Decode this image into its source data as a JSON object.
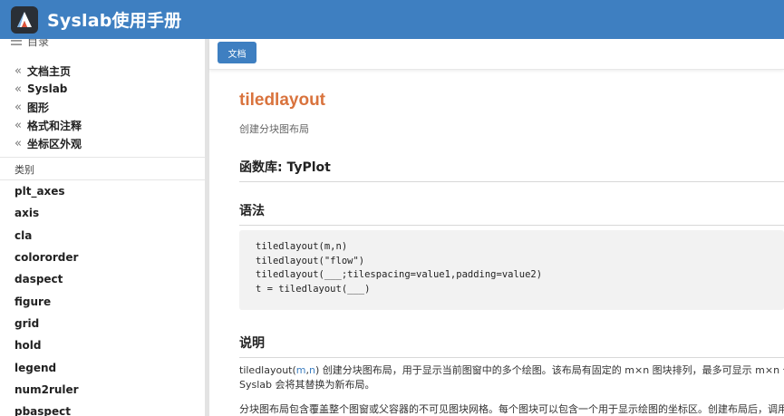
{
  "header": {
    "title": "Syslab使用手册",
    "logo_icon": "syslab-logo-icon",
    "background": "#3e7fc1"
  },
  "sidebar": {
    "toc_label": "目录",
    "breadcrumbs": [
      "文档主页",
      "Syslab",
      "图形",
      "格式和注释",
      "坐标区外观"
    ],
    "category_label": "类别",
    "functions": [
      "plt_axes",
      "axis",
      "cla",
      "colororder",
      "daspect",
      "figure",
      "grid",
      "hold",
      "legend",
      "num2ruler",
      "pbaspect"
    ]
  },
  "toolbar": {
    "doc_button": "文档"
  },
  "content": {
    "title": "tiledlayout",
    "subtitle": "创建分块图布局",
    "library_heading": "函数库: TyPlot",
    "syntax_heading": "语法",
    "syntax_lines": [
      "tiledlayout(m,n)",
      "tiledlayout(\"flow\")",
      "tiledlayout(___;tilespacing=value1,padding=value2)",
      "t = tiledlayout(___)"
    ],
    "description_heading": "说明",
    "description_p1_prefix": "tiledlayout(",
    "description_p1_m": "m",
    "description_p1_comma": ",",
    "description_p1_n": "n",
    "description_p1_rest": ") 创建分块图布局，用于显示当前图窗中的多个绘图。该布局有固定的 m×n 图块排列，最多可显示 m×n 个",
    "description_p1_line2": "Syslab 会将其替换为新布局。",
    "description_p2": "分块图布局包含覆盖整个图窗或父容器的不可见图块网格。每个图块可以包含一个用于显示绘图的坐标区。创建布局后，调用",
    "title_color": "#d9733d",
    "link_color": "#3e7fc1"
  }
}
